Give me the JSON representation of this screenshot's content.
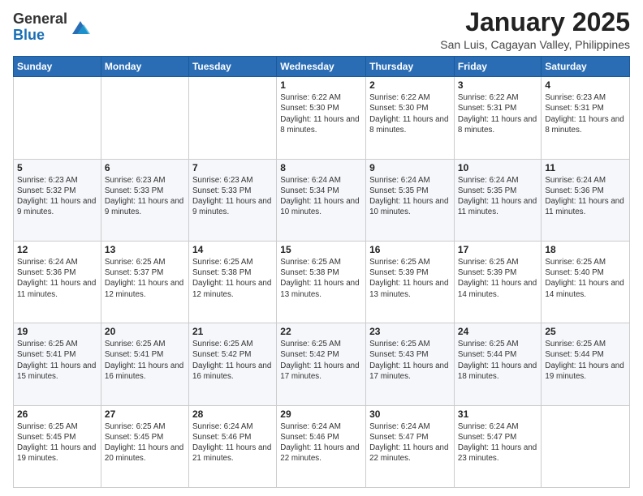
{
  "header": {
    "logo_general": "General",
    "logo_blue": "Blue",
    "month_title": "January 2025",
    "location": "San Luis, Cagayan Valley, Philippines"
  },
  "weekdays": [
    "Sunday",
    "Monday",
    "Tuesday",
    "Wednesday",
    "Thursday",
    "Friday",
    "Saturday"
  ],
  "weeks": [
    [
      {
        "day": "",
        "detail": ""
      },
      {
        "day": "",
        "detail": ""
      },
      {
        "day": "",
        "detail": ""
      },
      {
        "day": "1",
        "detail": "Sunrise: 6:22 AM\nSunset: 5:30 PM\nDaylight: 11 hours and 8 minutes."
      },
      {
        "day": "2",
        "detail": "Sunrise: 6:22 AM\nSunset: 5:30 PM\nDaylight: 11 hours and 8 minutes."
      },
      {
        "day": "3",
        "detail": "Sunrise: 6:22 AM\nSunset: 5:31 PM\nDaylight: 11 hours and 8 minutes."
      },
      {
        "day": "4",
        "detail": "Sunrise: 6:23 AM\nSunset: 5:31 PM\nDaylight: 11 hours and 8 minutes."
      }
    ],
    [
      {
        "day": "5",
        "detail": "Sunrise: 6:23 AM\nSunset: 5:32 PM\nDaylight: 11 hours and 9 minutes."
      },
      {
        "day": "6",
        "detail": "Sunrise: 6:23 AM\nSunset: 5:33 PM\nDaylight: 11 hours and 9 minutes."
      },
      {
        "day": "7",
        "detail": "Sunrise: 6:23 AM\nSunset: 5:33 PM\nDaylight: 11 hours and 9 minutes."
      },
      {
        "day": "8",
        "detail": "Sunrise: 6:24 AM\nSunset: 5:34 PM\nDaylight: 11 hours and 10 minutes."
      },
      {
        "day": "9",
        "detail": "Sunrise: 6:24 AM\nSunset: 5:35 PM\nDaylight: 11 hours and 10 minutes."
      },
      {
        "day": "10",
        "detail": "Sunrise: 6:24 AM\nSunset: 5:35 PM\nDaylight: 11 hours and 11 minutes."
      },
      {
        "day": "11",
        "detail": "Sunrise: 6:24 AM\nSunset: 5:36 PM\nDaylight: 11 hours and 11 minutes."
      }
    ],
    [
      {
        "day": "12",
        "detail": "Sunrise: 6:24 AM\nSunset: 5:36 PM\nDaylight: 11 hours and 11 minutes."
      },
      {
        "day": "13",
        "detail": "Sunrise: 6:25 AM\nSunset: 5:37 PM\nDaylight: 11 hours and 12 minutes."
      },
      {
        "day": "14",
        "detail": "Sunrise: 6:25 AM\nSunset: 5:38 PM\nDaylight: 11 hours and 12 minutes."
      },
      {
        "day": "15",
        "detail": "Sunrise: 6:25 AM\nSunset: 5:38 PM\nDaylight: 11 hours and 13 minutes."
      },
      {
        "day": "16",
        "detail": "Sunrise: 6:25 AM\nSunset: 5:39 PM\nDaylight: 11 hours and 13 minutes."
      },
      {
        "day": "17",
        "detail": "Sunrise: 6:25 AM\nSunset: 5:39 PM\nDaylight: 11 hours and 14 minutes."
      },
      {
        "day": "18",
        "detail": "Sunrise: 6:25 AM\nSunset: 5:40 PM\nDaylight: 11 hours and 14 minutes."
      }
    ],
    [
      {
        "day": "19",
        "detail": "Sunrise: 6:25 AM\nSunset: 5:41 PM\nDaylight: 11 hours and 15 minutes."
      },
      {
        "day": "20",
        "detail": "Sunrise: 6:25 AM\nSunset: 5:41 PM\nDaylight: 11 hours and 16 minutes."
      },
      {
        "day": "21",
        "detail": "Sunrise: 6:25 AM\nSunset: 5:42 PM\nDaylight: 11 hours and 16 minutes."
      },
      {
        "day": "22",
        "detail": "Sunrise: 6:25 AM\nSunset: 5:42 PM\nDaylight: 11 hours and 17 minutes."
      },
      {
        "day": "23",
        "detail": "Sunrise: 6:25 AM\nSunset: 5:43 PM\nDaylight: 11 hours and 17 minutes."
      },
      {
        "day": "24",
        "detail": "Sunrise: 6:25 AM\nSunset: 5:44 PM\nDaylight: 11 hours and 18 minutes."
      },
      {
        "day": "25",
        "detail": "Sunrise: 6:25 AM\nSunset: 5:44 PM\nDaylight: 11 hours and 19 minutes."
      }
    ],
    [
      {
        "day": "26",
        "detail": "Sunrise: 6:25 AM\nSunset: 5:45 PM\nDaylight: 11 hours and 19 minutes."
      },
      {
        "day": "27",
        "detail": "Sunrise: 6:25 AM\nSunset: 5:45 PM\nDaylight: 11 hours and 20 minutes."
      },
      {
        "day": "28",
        "detail": "Sunrise: 6:24 AM\nSunset: 5:46 PM\nDaylight: 11 hours and 21 minutes."
      },
      {
        "day": "29",
        "detail": "Sunrise: 6:24 AM\nSunset: 5:46 PM\nDaylight: 11 hours and 22 minutes."
      },
      {
        "day": "30",
        "detail": "Sunrise: 6:24 AM\nSunset: 5:47 PM\nDaylight: 11 hours and 22 minutes."
      },
      {
        "day": "31",
        "detail": "Sunrise: 6:24 AM\nSunset: 5:47 PM\nDaylight: 11 hours and 23 minutes."
      },
      {
        "day": "",
        "detail": ""
      }
    ]
  ]
}
